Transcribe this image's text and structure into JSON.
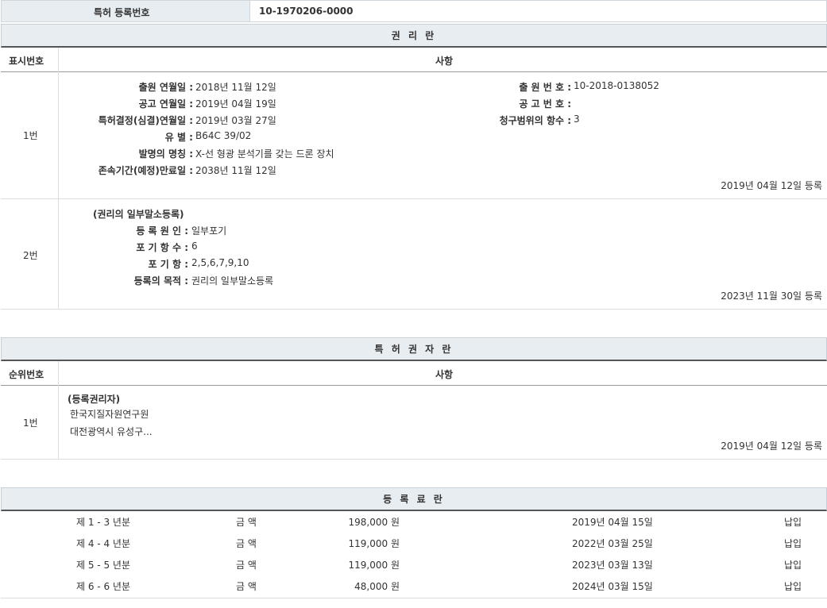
{
  "header": {
    "label": "특허 등록번호",
    "value": "10-1970206-0000"
  },
  "rights": {
    "title": "권 리 란",
    "col_index": "표시번호",
    "col_content": "사항",
    "entries": [
      {
        "index": "1번",
        "left_fields": [
          {
            "label": "출원 연월일 :",
            "value": "2018년 11월 12일"
          },
          {
            "label": "공고 연월일 :",
            "value": "2019년 04월 19일"
          },
          {
            "label": "특허결정(심결)연월일 :",
            "value": "2019년 03월 27일"
          },
          {
            "label": "유 별 :",
            "value": "B64C 39/02"
          },
          {
            "label": "발명의 명칭 :",
            "value": "X-선 형광 분석기를 갖는 드론 장치"
          },
          {
            "label": "존속기간(예정)만료일 :",
            "value": "2038년 11월 12일"
          }
        ],
        "right_fields": [
          {
            "label": "출 원 번 호 :",
            "value": "10-2018-0138052"
          },
          {
            "label": "공 고 번 호 :",
            "value": ""
          },
          {
            "label": "청구범위의 항수 :",
            "value": "3"
          }
        ],
        "registered": "2019년 04월 12일 등록"
      },
      {
        "index": "2번",
        "heading": "(권리의 일부말소등록)",
        "left_fields": [
          {
            "label": "등 록 원 인 :",
            "value": "일부포기"
          },
          {
            "label": "포 기 항 수 :",
            "value": "6"
          },
          {
            "label": "포 기 항 :",
            "value": "2,5,6,7,9,10"
          },
          {
            "label": "등록의 목적 :",
            "value": "권리의 일부말소등록"
          }
        ],
        "registered": "2023년 11월 30일 등록"
      }
    ]
  },
  "holders": {
    "title": "특 허 권 자 란",
    "col_index": "순위번호",
    "col_content": "사항",
    "entries": [
      {
        "index": "1번",
        "heading": "(등록권리자)",
        "name": "한국지질자원연구원",
        "address": "대전광역시 유성구...",
        "registered": "2019년 04월 12일 등록"
      }
    ]
  },
  "fees": {
    "title": "등 록 료 란",
    "rows": [
      {
        "period": "제 1 - 3 년분",
        "amount_label": "금 액",
        "amount": "198,000 원",
        "date": "2019년 04월 15일",
        "status": "납입"
      },
      {
        "period": "제 4 - 4 년분",
        "amount_label": "금 액",
        "amount": "119,000 원",
        "date": "2022년 03월 25일",
        "status": "납입"
      },
      {
        "period": "제 5 - 5 년분",
        "amount_label": "금 액",
        "amount": "119,000 원",
        "date": "2023년 03월 13일",
        "status": "납입"
      },
      {
        "period": "제 6 - 6 년분",
        "amount_label": "금 액",
        "amount": "48,000 원",
        "date": "2024년 03월 15일",
        "status": "납입"
      }
    ]
  }
}
